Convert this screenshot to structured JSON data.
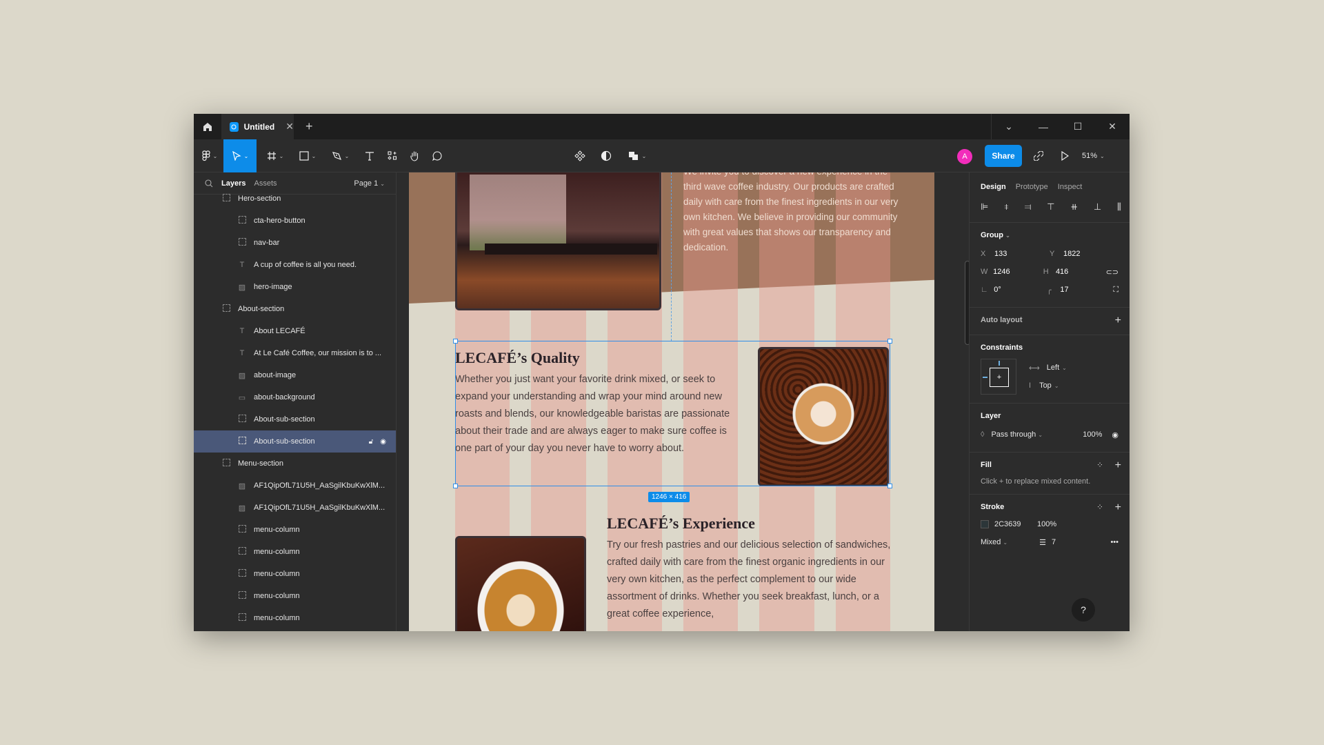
{
  "tabbar": {
    "tab_title": "Untitled",
    "icons": {
      "home": "home-icon",
      "close": "close-icon",
      "add": "plus-icon"
    },
    "close_glyph": "✕",
    "add_glyph": "+",
    "window_controls": {
      "dropdown": "⌄",
      "minimize": "—",
      "maximize": "☐",
      "close": "✕"
    }
  },
  "toolbar": {
    "tools": [
      "main-menu",
      "move",
      "frame",
      "shape",
      "pen",
      "text",
      "resources",
      "hand",
      "comment"
    ],
    "active_tool": "move",
    "center_tools": [
      "components",
      "mask",
      "boolean-union"
    ],
    "avatar_initial": "A",
    "avatar_color": "#f22dbb",
    "share_label": "Share",
    "zoom_level": "51%"
  },
  "layers_panel": {
    "tab_layers": "Layers",
    "tab_assets": "Assets",
    "page_selector": "Page 1",
    "items": [
      {
        "label": "Hero-section",
        "type": "frame",
        "level": 1
      },
      {
        "label": "cta-hero-button",
        "type": "frame",
        "level": 2
      },
      {
        "label": "nav-bar",
        "type": "frame",
        "level": 2
      },
      {
        "label": "A cup of coffee is all you need.",
        "type": "text",
        "level": 2
      },
      {
        "label": "hero-image",
        "type": "image",
        "level": 2
      },
      {
        "label": "About-section",
        "type": "frame",
        "level": 1
      },
      {
        "label": "About LECAFÉ",
        "type": "text",
        "level": 2
      },
      {
        "label": "At Le Café Coffee, our mission is to ...",
        "type": "text",
        "level": 2
      },
      {
        "label": "about-image",
        "type": "image",
        "level": 2
      },
      {
        "label": "about-background",
        "type": "rect",
        "level": 2
      },
      {
        "label": "About-sub-section",
        "type": "frame",
        "level": 2
      },
      {
        "label": "About-sub-section",
        "type": "frame",
        "level": 2,
        "selected": true
      },
      {
        "label": "Menu-section",
        "type": "frame",
        "level": 1
      },
      {
        "label": "AF1QipOfL71U5H_AaSgilKbuKwXlM...",
        "type": "image",
        "level": 2
      },
      {
        "label": "AF1QipOfL71U5H_AaSgilKbuKwXlM...",
        "type": "image",
        "level": 2
      },
      {
        "label": "menu-column",
        "type": "frame",
        "level": 2
      },
      {
        "label": "menu-column",
        "type": "frame",
        "level": 2
      },
      {
        "label": "menu-column",
        "type": "frame",
        "level": 2
      },
      {
        "label": "menu-column",
        "type": "frame",
        "level": 2
      },
      {
        "label": "menu-column",
        "type": "frame",
        "level": 2
      }
    ]
  },
  "canvas": {
    "hero_text": "We invite you to discover a new experience in the third wave coffee industry. Our products are crafted daily with care from the finest ingredients in our very own kitchen. We believe in providing our community with great values that shows our transparency and dedication.",
    "quality_heading": "LECAFÉ’s Quality",
    "quality_body": "Whether you just want your favorite drink mixed, or seek to expand your understanding and wrap your mind around new roasts and blends, our knowledgeable baristas are passionate about their trade and are always eager to make sure coffee is one part of your day you never have to worry about.",
    "experience_heading": "LECAFÉ’s Experience",
    "experience_body": "Try our fresh pastries and our delicious selection of sandwiches, crafted daily with care from the finest organic ingredients in our very own kitchen, as the perfect complement to our wide assortment of drinks. Whether you seek breakfast, lunch, or a great coffee experience,",
    "selection_size": "1246 × 416",
    "colors": {
      "page_bg": "#dcd8ca",
      "hero_band": "#987259",
      "selection": "#2f8ee8"
    }
  },
  "design_panel": {
    "tabs": [
      "Design",
      "Prototype",
      "Inspect"
    ],
    "active_tab": "Design",
    "group_label": "Group",
    "x_label": "X",
    "x": "133",
    "y_label": "Y",
    "y": "1822",
    "w_label": "W",
    "w": "1246",
    "h_label": "H",
    "h": "416",
    "rotation": "0°",
    "radius": "17",
    "auto_layout": "Auto layout",
    "constraints_title": "Constraints",
    "constraint_h": "Left",
    "constraint_v": "Top",
    "layer_title": "Layer",
    "blend_mode": "Pass through",
    "opacity": "100%",
    "fill_title": "Fill",
    "fill_hint": "Click + to replace mixed content.",
    "stroke_title": "Stroke",
    "stroke_color": "2C3639",
    "stroke_opacity": "100%",
    "stroke_position": "Mixed",
    "stroke_weight": "7",
    "help": "?"
  }
}
